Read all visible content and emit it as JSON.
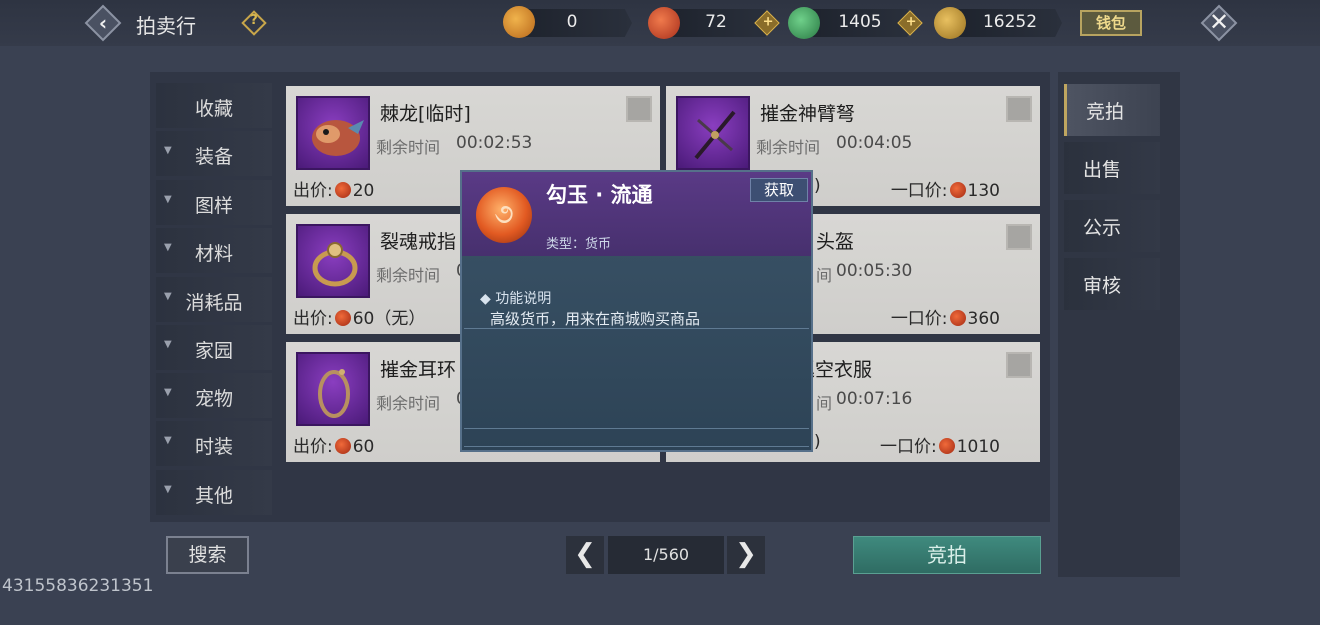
{
  "header": {
    "title": "拍卖行",
    "help_icon": "?",
    "back_icon": "‹",
    "close_icon": "✕",
    "wallet_label": "钱包"
  },
  "currencies": [
    {
      "name": "bag-icon",
      "value": "0",
      "color": "#d18a2c"
    },
    {
      "name": "gouyu-icon",
      "value": "72",
      "color": "#e0552a"
    },
    {
      "name": "jade-icon",
      "value": "1405",
      "color": "#3ca05a"
    },
    {
      "name": "feather-icon",
      "value": "16252",
      "color": "#caa040"
    }
  ],
  "plus_icon": "+",
  "categories": [
    "收藏",
    "装备",
    "图样",
    "材料",
    "消耗品",
    "家园",
    "宠物",
    "时装",
    "其他"
  ],
  "listings": [
    {
      "name": "棘龙[临时]",
      "time_label": "剩余时间",
      "time": "00:02:53",
      "price_label": "出价:",
      "price": "20",
      "buyout_label": "",
      "buyout": ""
    },
    {
      "name": "摧金神臂弩",
      "time_label": "剩余时间",
      "time": "00:04:05",
      "price_label": "",
      "price": ")",
      "buyout_label": "一口价:",
      "buyout": "130"
    },
    {
      "name": "裂魂戒指",
      "time_label": "剩余时间",
      "time": "0",
      "price_label": "出价:",
      "price": "60（无）",
      "buyout_label": "",
      "buyout": ""
    },
    {
      "name": "头盔",
      "time_label": "间",
      "time": "00:05:30",
      "price_label": "",
      "price": "",
      "buyout_label": "一口价:",
      "buyout": "360"
    },
    {
      "name": "摧金耳环",
      "time_label": "剩余时间",
      "time": "0",
      "price_label": "出价:",
      "price": "60",
      "buyout_label": "",
      "buyout": ""
    },
    {
      "name": "巡空衣服",
      "time_label": "间",
      "time": "00:07:16",
      "price_label": "",
      "price": ")",
      "buyout_label": "一口价:",
      "buyout": "1010"
    }
  ],
  "tabs": [
    "竞拍",
    "出售",
    "公示",
    "审核"
  ],
  "bottom": {
    "search_label": "搜索",
    "prev_icon": "❮",
    "page": "1/560",
    "next_icon": "❯",
    "bid_label": "竞拍"
  },
  "uid": "43155836231351",
  "tooltip": {
    "title": "勾玉 · 流通",
    "get_label": "获取",
    "type_text": "类型：货币",
    "section_title": "功能说明",
    "description": "高级货币，用来在商城购买商品",
    "icon_glyph": "૭"
  }
}
